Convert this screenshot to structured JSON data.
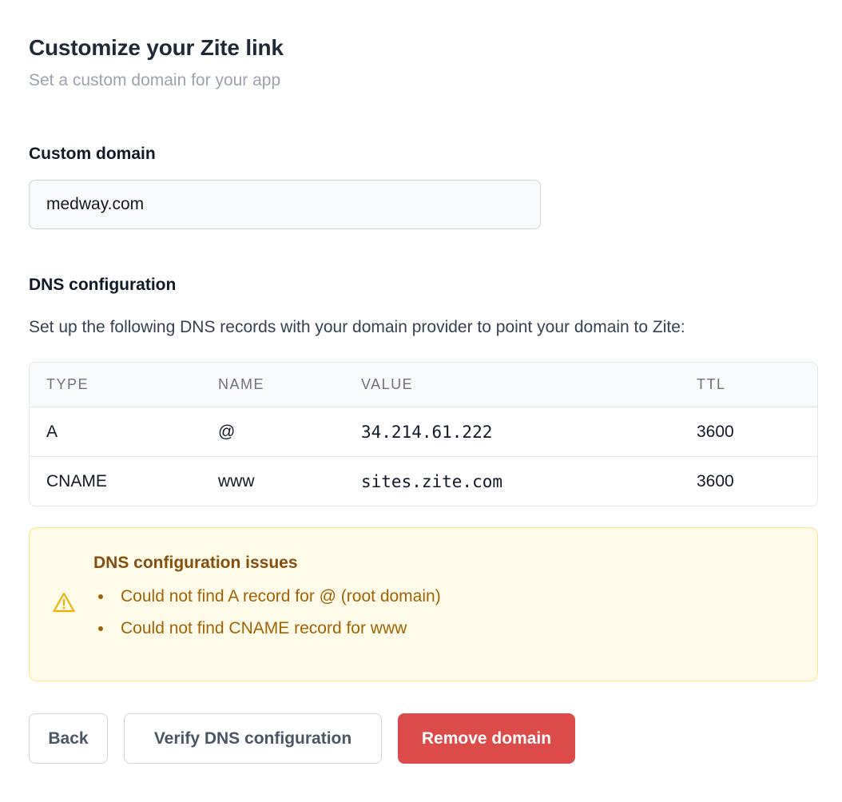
{
  "header": {
    "title": "Customize your Zite link",
    "subtitle": "Set a custom domain for your app"
  },
  "custom_domain": {
    "label": "Custom domain",
    "value": "medway.com"
  },
  "dns": {
    "title": "DNS configuration",
    "description": "Set up the following DNS records with your domain provider to point your domain to Zite:",
    "columns": [
      "TYPE",
      "NAME",
      "VALUE",
      "TTL"
    ],
    "rows": [
      {
        "type": "A",
        "name": "@",
        "value": "34.214.61.222",
        "ttl": "3600"
      },
      {
        "type": "CNAME",
        "name": "www",
        "value": "sites.zite.com",
        "ttl": "3600"
      }
    ]
  },
  "alert": {
    "icon": "warning-icon",
    "title": "DNS configuration issues",
    "items": [
      "Could not find A record for @ (root domain)",
      "Could not find CNAME record for www"
    ],
    "colors": {
      "background": "#fefce8",
      "border": "#fde68a",
      "text": "#a16207"
    }
  },
  "actions": {
    "back_label": "Back",
    "verify_label": "Verify DNS configuration",
    "remove_label": "Remove domain",
    "remove_color": "#dc4a4a"
  }
}
